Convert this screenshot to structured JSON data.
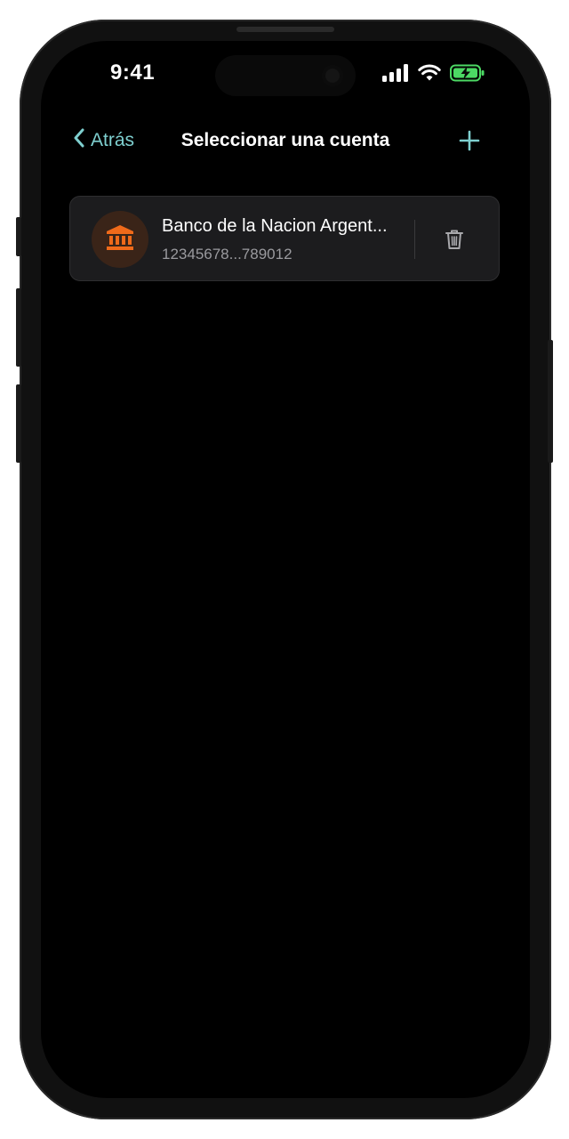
{
  "status_bar": {
    "time": "9:41",
    "signal_icon": "cellular-signal-icon",
    "wifi_icon": "wifi-icon",
    "battery_icon": "battery-charging-icon"
  },
  "nav": {
    "back_label": "Atrás",
    "back_icon": "chevron-left-icon",
    "title": "Seleccionar una cuenta",
    "add_icon": "plus-icon"
  },
  "accounts": [
    {
      "name": "Banco de la Nacion Argent...",
      "number": "12345678...789012",
      "icon": "bank-icon",
      "delete_icon": "trash-icon"
    }
  ],
  "colors": {
    "accent": "#7ecfcf",
    "bank_icon": "#f06a1a",
    "battery": "#4cd964",
    "background": "#000000",
    "card": "#1c1c1e"
  }
}
